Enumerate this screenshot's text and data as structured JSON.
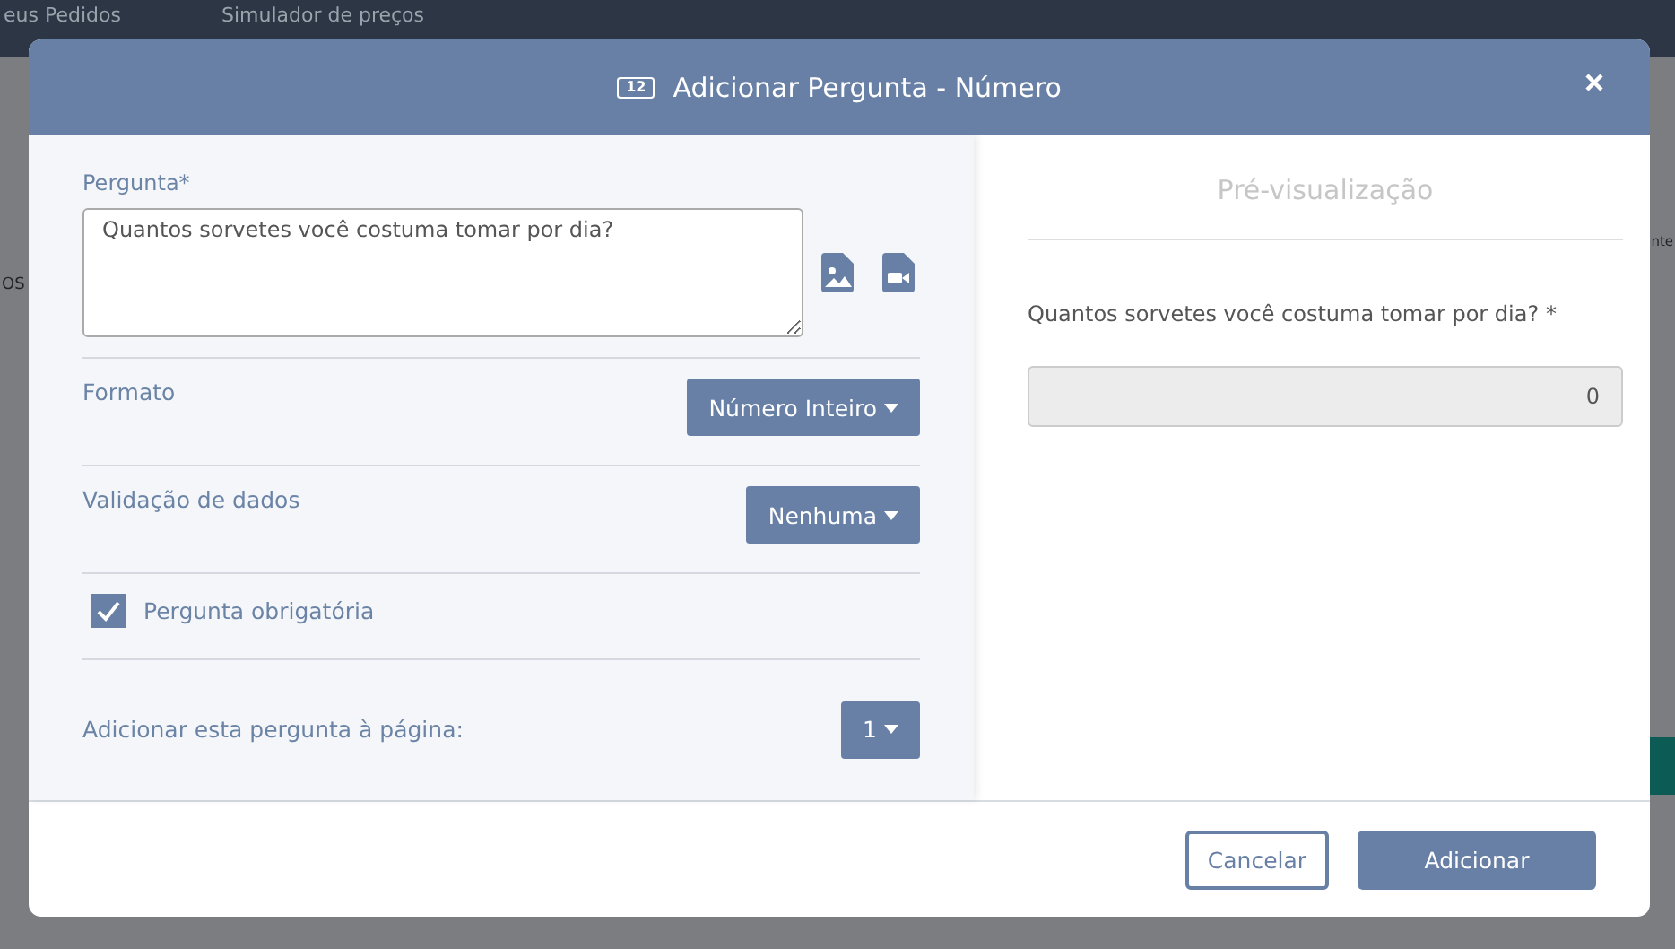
{
  "background": {
    "nav_items": [
      "eus Pedidos",
      "Simulador de preços"
    ],
    "left_fragment": "OS",
    "right_fragment": "nte"
  },
  "dialog": {
    "title": "Adicionar Pergunta - Número",
    "title_badge": "12",
    "question": {
      "label": "Pergunta*",
      "value": "Quantos sorvetes você costuma tomar por dia?"
    },
    "settings": [
      {
        "kind": "dropdown",
        "label": "Formato",
        "value": "Número Inteiro"
      },
      {
        "kind": "dropdown",
        "label": "Validação de dados",
        "value": "Nenhuma"
      },
      {
        "kind": "checkbox",
        "label": "Pergunta obrigatória",
        "checked": true
      },
      {
        "kind": "dropdown",
        "label": "Adicionar esta pergunta à página:",
        "value": "1"
      }
    ],
    "preview": {
      "title": "Pré-visualização",
      "question": "Quantos sorvetes você costuma tomar por dia?",
      "required_mark": "*",
      "value": "0"
    },
    "buttons": [
      {
        "kind": "secondary",
        "label": "Cancelar"
      },
      {
        "kind": "primary",
        "label": "Adicionar"
      }
    ]
  }
}
